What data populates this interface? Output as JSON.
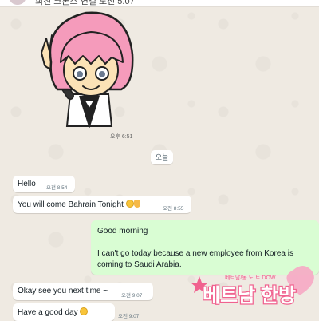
{
  "header": {
    "title": "희진 크론스 연결 도전 5.07"
  },
  "sticker": {
    "time": "오후 6:51"
  },
  "date_divider": {
    "label": "오늘"
  },
  "messages": [
    {
      "direction": "incoming",
      "text": "Hello",
      "time": "오전 8:54"
    },
    {
      "direction": "incoming",
      "text": "You will come Bahrain Tonight",
      "emoji": [
        "smiling-face-icon",
        "hand-icon"
      ],
      "time": "오전 8:55"
    },
    {
      "direction": "outgoing",
      "lines": [
        "Good morning",
        "I can't go today because a new employee from Korea is",
        "coming to Saudi Arabia."
      ]
    },
    {
      "direction": "incoming",
      "text": "Okay see you next time ~",
      "time": "오전 9:07"
    },
    {
      "direction": "incoming",
      "text": "Have a good day",
      "emoji": [
        "smiling-face-icon"
      ],
      "time": "오전 9:07"
    }
  ],
  "watermark": {
    "main": "베트남 한방",
    "sub": "베트남/동 노 트 DOW"
  },
  "colors": {
    "wallpaper": "#efeae2",
    "incoming_bubble": "#ffffff",
    "outgoing_bubble": "#d9fdd3",
    "watermark_pink": "#f0628f"
  }
}
